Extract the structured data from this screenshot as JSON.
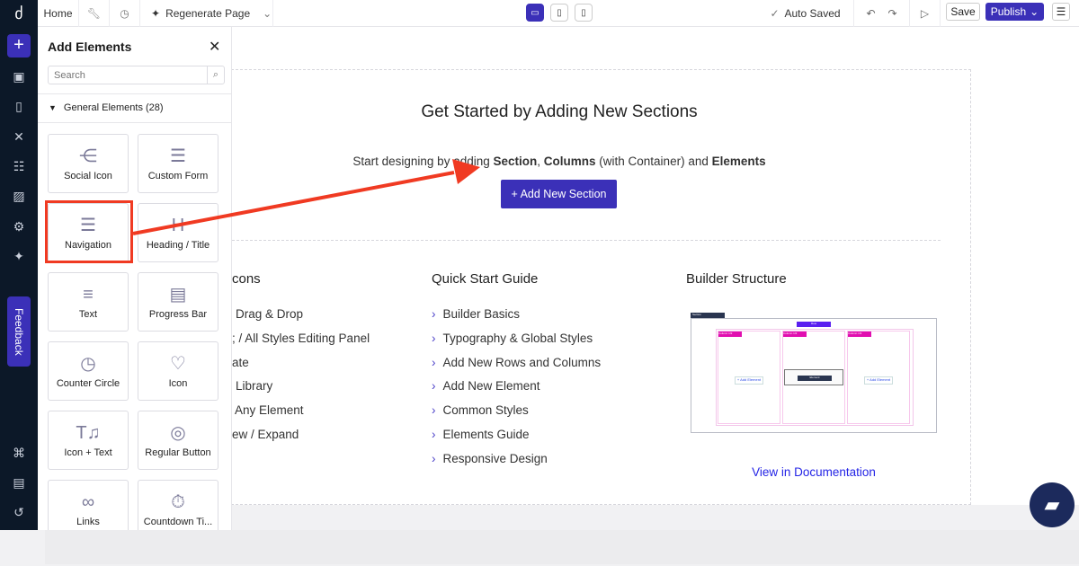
{
  "topbar": {
    "home": "Home",
    "regenerate": "Regenerate Page",
    "auto_saved": "Auto Saved",
    "save": "Save",
    "publish": "Publish"
  },
  "rail": {
    "feedback": "Feedback"
  },
  "panel": {
    "title": "Add Elements",
    "search_placeholder": "Search",
    "group": "General Elements (28)",
    "items": [
      {
        "label": "Social Icon",
        "icon": "share-icon"
      },
      {
        "label": "Custom Form",
        "icon": "form-icon"
      },
      {
        "label": "Navigation",
        "icon": "menu-icon"
      },
      {
        "label": "Heading / Title",
        "icon": "heading-icon"
      },
      {
        "label": "Text",
        "icon": "text-icon"
      },
      {
        "label": "Progress Bar",
        "icon": "progress-icon"
      },
      {
        "label": "Counter Circle",
        "icon": "clock-icon"
      },
      {
        "label": "Icon",
        "icon": "icons-icon"
      },
      {
        "label": "Icon + Text",
        "icon": "icon-text-icon"
      },
      {
        "label": "Regular Button",
        "icon": "button-icon"
      },
      {
        "label": "Links",
        "icon": "link-icon"
      },
      {
        "label": "Countdown Ti...",
        "icon": "stopwatch-icon"
      }
    ]
  },
  "main": {
    "title": "Get Started by Adding New Sections",
    "subtitle_pre": "Start designing by adding ",
    "subtitle_b1": "Section",
    "subtitle_sep": ", ",
    "subtitle_b2": "Columns",
    "subtitle_mid": " (with Container) and ",
    "subtitle_b3": "Elements",
    "add_section": "+ Add New Section",
    "col1": {
      "title": "cons",
      "items": [
        "Drag & Drop",
        "; / All Styles Editing Panel",
        "ate",
        "Library",
        "Any Element",
        "ew / Expand"
      ]
    },
    "col2": {
      "title": "Quick Start Guide",
      "items": [
        "Builder Basics",
        "Typography & Global Styles",
        "Add New Rows and Columns",
        "Add New Element",
        "Common Styles",
        "Elements Guide",
        "Responsive Design"
      ]
    },
    "col3": {
      "title": "Builder Structure",
      "link": "View in Documentation",
      "diagram": {
        "section": "Section",
        "row": "Row",
        "columns": [
          "Column 1/3",
          "Column 1/3",
          "Column 1/3"
        ],
        "add": "+ Add Element",
        "element": "Element"
      }
    }
  },
  "colors": {
    "accent": "#3b30b8",
    "link": "#2424e6",
    "highlight": "#f03a22",
    "rail": "#0c1828"
  }
}
